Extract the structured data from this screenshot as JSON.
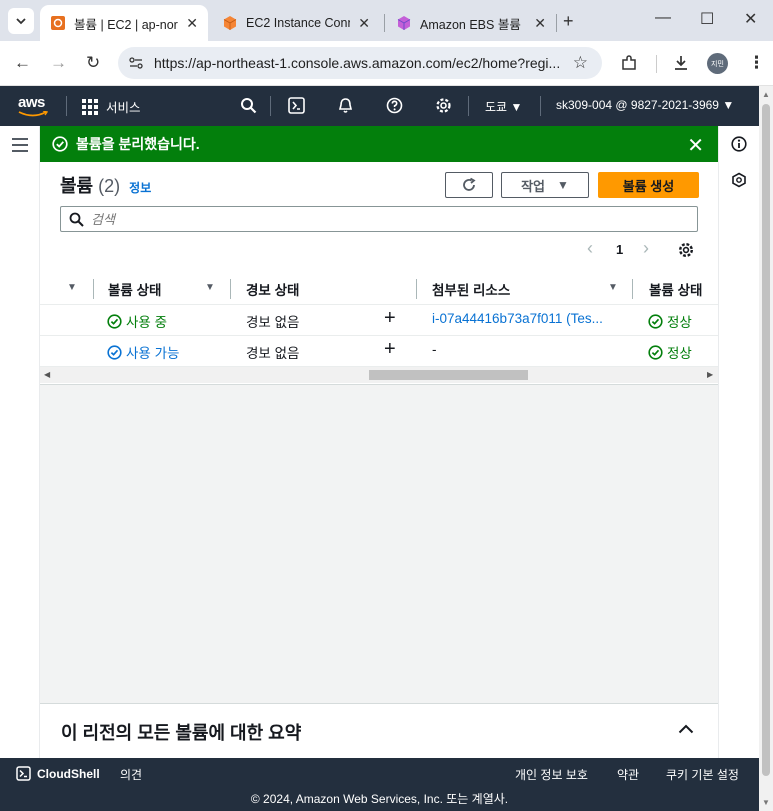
{
  "browser": {
    "tabs": [
      {
        "title": "볼륨 | EC2 | ap-nor",
        "active": true,
        "icon": "aws-ec2-favicon"
      },
      {
        "title": "EC2 Instance Conn",
        "active": false,
        "icon": "ec2-orange-cube-favicon"
      },
      {
        "title": "Amazon EBS 볼륨",
        "active": false,
        "icon": "purple-cube-favicon"
      }
    ],
    "url": "https://ap-northeast-1.console.aws.amazon.com/ec2/home?regi...",
    "profile_initials": "지민"
  },
  "aws_nav": {
    "logo": "aws",
    "services_label": "서비스",
    "region": "도쿄",
    "account": "sk309-004 @ 9827-2021-3969"
  },
  "flash": {
    "message": "볼륨을 분리했습니다."
  },
  "panel": {
    "title": "볼륨",
    "count": "(2)",
    "info_link": "정보",
    "actions_label": "작업",
    "create_label": "볼륨 생성",
    "search_placeholder": "검색",
    "page_number": "1"
  },
  "table": {
    "headers": [
      "볼륨 상태",
      "경보 상태",
      "첨부된 리소스",
      "볼륨 상태"
    ],
    "rows": [
      {
        "volume_state": "사용 중",
        "alarm": "경보 없음",
        "attached": "i-07a44416b73a7f011 (Tes...",
        "status": "정상"
      },
      {
        "volume_state": "사용 가능",
        "alarm": "경보 없음",
        "attached": "-",
        "status": "정상"
      }
    ]
  },
  "summary": {
    "title": "이 리전의 모든 볼륨에 대한 요약"
  },
  "footer": {
    "cloudshell": "CloudShell",
    "feedback": "의견",
    "privacy": "개인 정보 보호",
    "terms": "약관",
    "cookies": "쿠키 기본 설정",
    "copyright": "© 2024, Amazon Web Services, Inc. 또는 계열사."
  },
  "colors": {
    "aws_nav_bg": "#232f3e",
    "flash_success": "#037f0c",
    "primary_button": "#ff9900",
    "link": "#0972d3"
  }
}
